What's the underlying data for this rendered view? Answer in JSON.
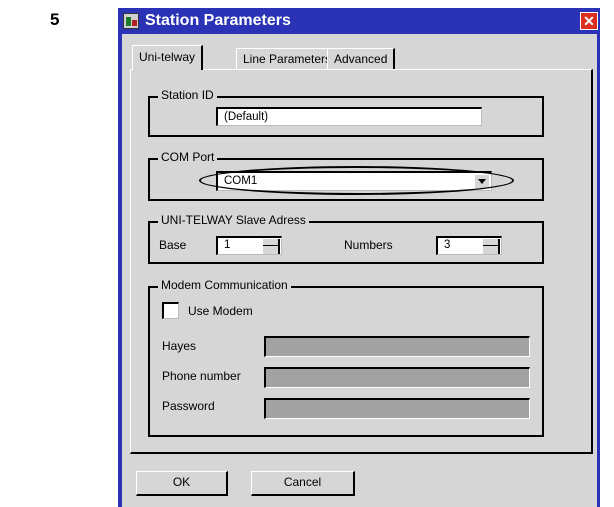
{
  "step_number": "5",
  "window": {
    "title": "Station Parameters",
    "close_glyph": "✕"
  },
  "tabs": [
    {
      "label": "Uni-telway"
    },
    {
      "label": "Line Parameters"
    },
    {
      "label": "Advanced"
    }
  ],
  "station_id": {
    "group_label": "Station ID",
    "value": "(Default)"
  },
  "com_port": {
    "group_label": "COM Port",
    "selected": "COM1"
  },
  "slave_address": {
    "group_label": "UNI-TELWAY Slave Adress",
    "base_label": "Base",
    "base_value": "1",
    "numbers_label": "Numbers",
    "numbers_value": "3"
  },
  "modem": {
    "group_label": "Modem Communication",
    "use_modem_label": "Use Modem",
    "use_modem_checked": false,
    "hayes_label": "Hayes",
    "phone_label": "Phone number",
    "password_label": "Password"
  },
  "buttons": {
    "ok": "OK",
    "cancel": "Cancel"
  },
  "colors": {
    "title_bar": "#2a32b6",
    "dialog_face": "#d6d6d6",
    "close_button": "#dc2e1f",
    "disabled_field": "#a2a2a2"
  },
  "icons": {
    "app": "app-icon",
    "close": "close-icon",
    "dropdown": "chevron-down-icon"
  }
}
